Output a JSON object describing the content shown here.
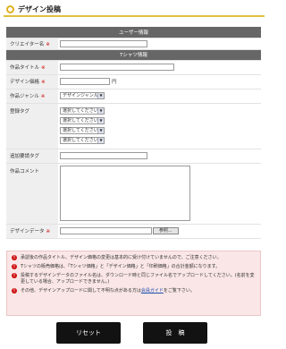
{
  "page": {
    "title": "デザイン投稿"
  },
  "sections": {
    "user_info": "ユーザー情報",
    "tshirt_info": "Tシャツ情報"
  },
  "fields": {
    "creator_name": {
      "label": "クリエイター名",
      "required_mark": "※",
      "value": ""
    },
    "work_title": {
      "label": "作品タイトル",
      "required_mark": "※",
      "value": ""
    },
    "design_price": {
      "label": "デザイン価格",
      "required_mark": "※",
      "value": "",
      "unit": "円"
    },
    "work_genre": {
      "label": "作品ジャンル",
      "required_mark": "※",
      "selected": "デザインジャンル1"
    },
    "registered_tags": {
      "label": "登録タグ",
      "options": [
        "選択してください",
        "選択してください",
        "選択してください",
        "選択してください"
      ]
    },
    "additional_tag": {
      "label": "追加要請タグ",
      "value": ""
    },
    "work_comment": {
      "label": "作品コメント",
      "value": ""
    },
    "design_data": {
      "label": "デザインデータ",
      "required_mark": "※",
      "value": "",
      "browse_label": "参照..."
    }
  },
  "notes": [
    {
      "text": "承認後の作品タイトル、デザイン価格の変更は基本的に受け付けていませんので、ご注意ください。"
    },
    {
      "text": "Tシャツの販売価格は、「Tシャツ価格」と「デザイン価格」と「印刷価格」の合計金額になります。"
    },
    {
      "text": "投稿するデザインデータのファイル名は、ダウンロード時と同じファイル名でアップロードしてください。(名前を変更している場合、アップロードできません。)"
    },
    {
      "text_before": "その他、デザインアップロードに関して不明な点がある方は",
      "link": "会員ガイド",
      "text_after": "をご覧下さい。"
    }
  ],
  "buttons": {
    "reset": "リセット",
    "submit": "投　稿"
  },
  "colors": {
    "accent": "#e0b020",
    "header_bg": "#666666",
    "label_bg": "#efefef",
    "notes_bg": "#fae6e6",
    "notes_icon": "#cc1111",
    "button_bg": "#121212",
    "link": "#1f4fb0"
  }
}
